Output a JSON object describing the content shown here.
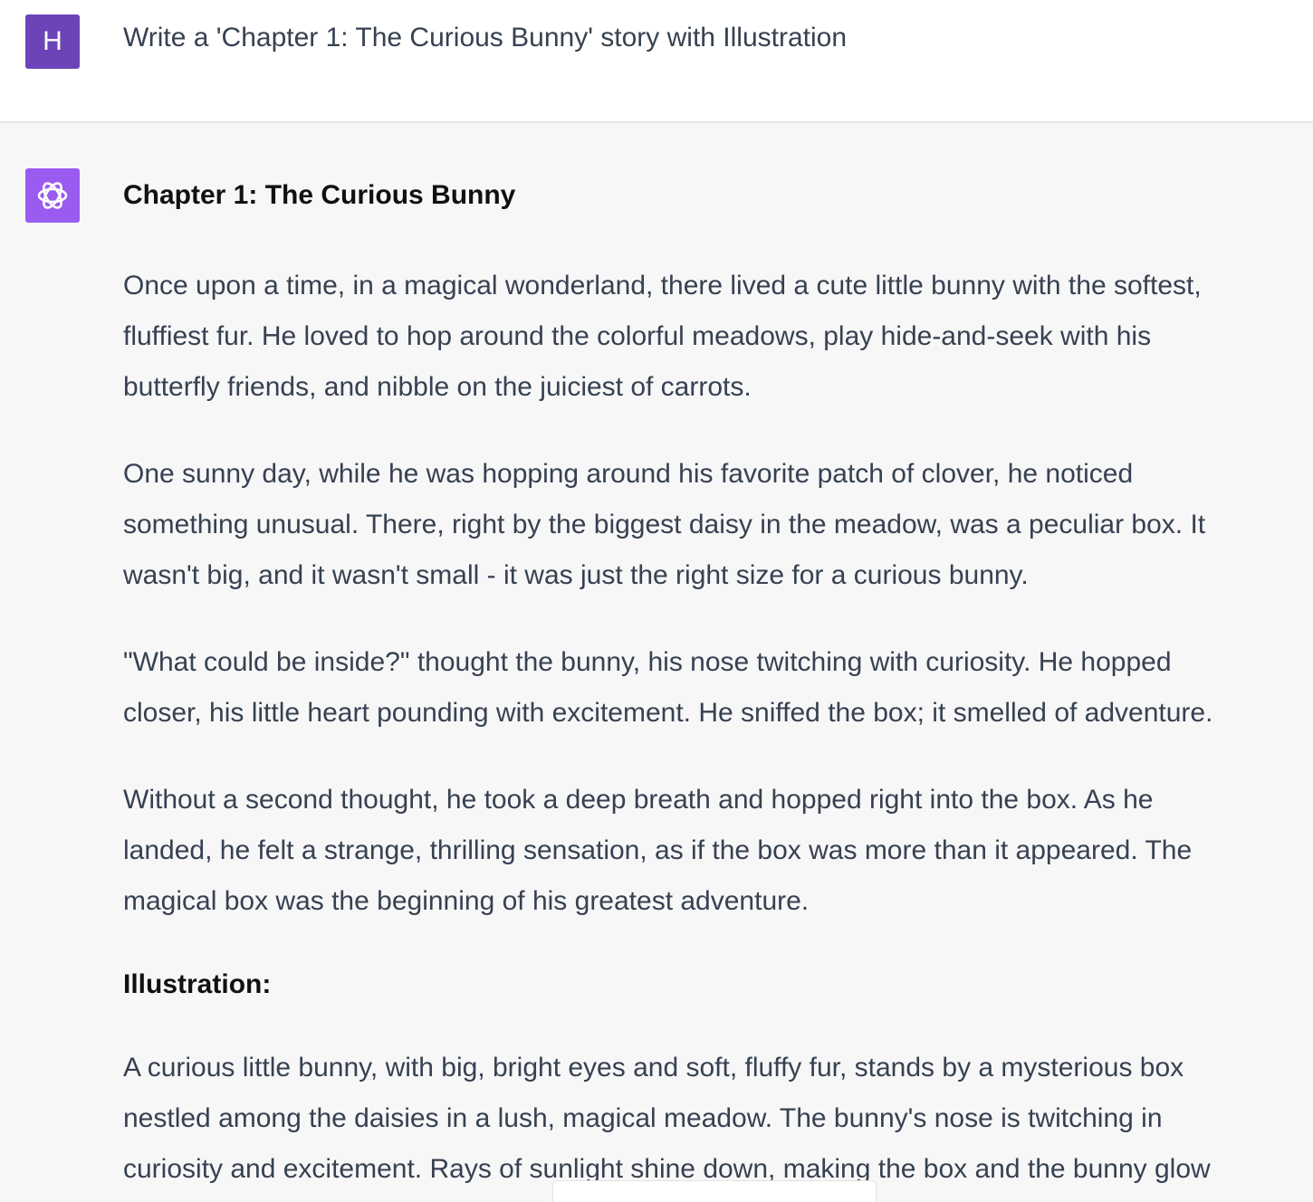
{
  "user": {
    "avatar_letter": "H",
    "avatar_color": "#6b45b8",
    "message": "Write a 'Chapter 1: The Curious Bunny' story with Illustration"
  },
  "assistant": {
    "avatar_icon": "openai-logo-icon",
    "avatar_color": "#9a5cf0",
    "title": "Chapter 1: The Curious Bunny",
    "paragraphs": [
      "Once upon a time, in a magical wonderland, there lived a cute little bunny with the softest,\nfluffiest fur. He loved to hop around the colorful meadows, play hide-and-seek with his\nbutterfly friends, and nibble on the juiciest of carrots.",
      "One sunny day, while he was hopping around his favorite patch of clover, he noticed\nsomething unusual. There, right by the biggest daisy in the meadow, was a peculiar box. It\nwasn't big, and it wasn't small - it was just the right size for a curious bunny.",
      "\"What could be inside?\" thought the bunny, his nose twitching with curiosity. He hopped\ncloser, his little heart pounding with excitement. He sniffed the box; it smelled of adventure.",
      "Without a second thought, he took a deep breath and hopped right into the box. As he\nlanded, he felt a strange, thrilling sensation, as if the box was more than it appeared. The\nmagical box was the beginning of his greatest adventure."
    ],
    "illustration_heading": "Illustration:",
    "illustration_text": "A curious little bunny, with big, bright eyes and soft, fluffy fur, stands by a mysterious box\nnestled among the daisies in a lush, magical meadow. The bunny's nose is twitching in\ncuriosity and excitement. Rays of sunlight shine down, making the box and the bunny glow"
  }
}
